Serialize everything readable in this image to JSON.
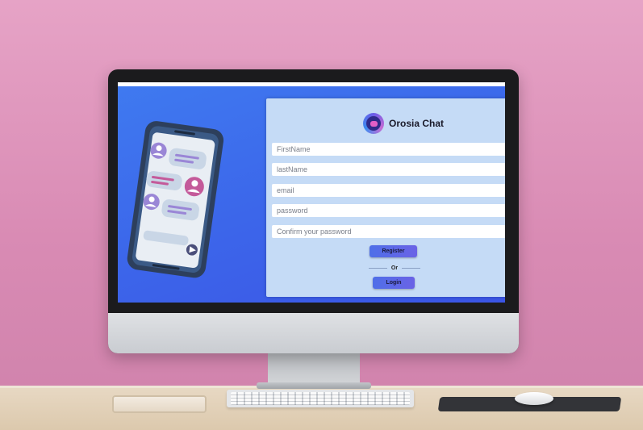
{
  "app": {
    "brand_name": "Orosia Chat"
  },
  "form": {
    "first_name_placeholder": "FirstName",
    "last_name_placeholder": "lastName",
    "email_placeholder": "email",
    "password_placeholder": "password",
    "confirm_password_placeholder": "Confirm your password",
    "register_label": "Register",
    "or_label": "Or",
    "login_label": "Login"
  },
  "icons": [
    "logo-icon",
    "phone-illustration",
    "send-icon",
    "avatar-icon"
  ],
  "colors": {
    "screen_bg": "#3c66ea",
    "card_bg": "#c5dbf6",
    "button": "#5a68e7",
    "wall": "#d98bb4"
  }
}
